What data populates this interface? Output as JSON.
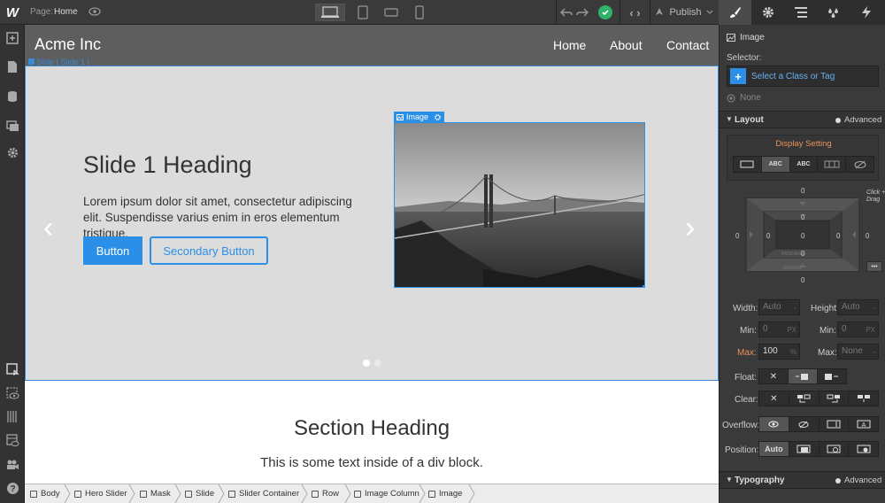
{
  "topbar": {
    "logo": "W",
    "page_label": "Page:",
    "page_name": "Home",
    "publish_label": "Publish",
    "code_label": "‹ ›"
  },
  "site": {
    "brand": "Acme Inc",
    "nav": [
      "Home",
      "About",
      "Contact"
    ],
    "slide_tag": "Slide | Slide 1 |",
    "image_tag": "Image",
    "slide_heading": "Slide 1 Heading",
    "slide_text": "Lorem ipsum dolor sit amet, consectetur adipiscing elit. Suspendisse varius enim in eros elementum tristique.",
    "button_label": "Button",
    "secondary_button_label": "Secondary Button",
    "arrow_left": "‹",
    "arrow_right": "›",
    "section_heading": "Section Heading",
    "section_text": "This is some text inside of a div block."
  },
  "breadcrumbs": [
    "Body",
    "Hero Slider",
    "Mask",
    "Slide",
    "Slider Container",
    "Row",
    "Image Column",
    "Image"
  ],
  "panel": {
    "element_name": "Image",
    "selector_label": "Selector:",
    "selector_placeholder": "Select a Class or Tag",
    "none_label": "None",
    "layout_title": "Layout",
    "advanced_label": "Advanced",
    "display_setting_label": "Display Setting",
    "display_options": [
      "",
      "ABC",
      "ABC",
      "",
      ""
    ],
    "click_drag_hint": "Click + Drag",
    "margin_label": "MARGIN",
    "padding_label": "PADDING",
    "box_values": {
      "mt": "0",
      "mr": "0",
      "mb": "0",
      "ml": "0",
      "pt": "0",
      "pr": "0",
      "pb": "0",
      "pl": "0",
      "center": "0"
    },
    "width_label": "Width:",
    "width_value": "Auto",
    "height_label": "Height:",
    "height_value": "Auto",
    "min_label": "Min:",
    "min_w": "0",
    "min_h": "0",
    "max_label": "Max:",
    "max_w": "100",
    "max_h": "None",
    "unit_px": "PX",
    "unit_pct": "%",
    "float_label": "Float:",
    "clear_label": "Clear:",
    "overflow_label": "Overflow:",
    "position_label": "Position:",
    "position_value": "Auto",
    "typography_title": "Typography",
    "typography_advanced": "Advanced",
    "x_symbol": "✕",
    "dots": "•••"
  },
  "colors": {
    "accent_blue": "#3a8ad6",
    "button_blue": "#2b8fe8",
    "warning_orange": "#e8935a",
    "publish_green": "#2fb36b"
  }
}
